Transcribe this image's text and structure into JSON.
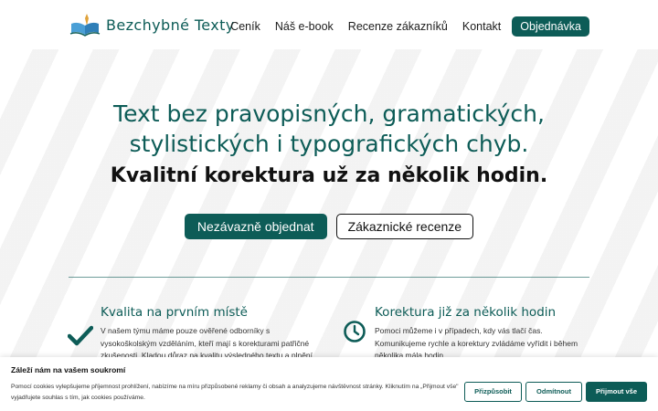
{
  "brand": {
    "name": "Bezchybné Texty",
    "logo_icon": "open-book-quill-icon",
    "accent": "#0d5c57"
  },
  "nav": {
    "items": [
      {
        "label": "Ceník"
      },
      {
        "label": "Náš e-book"
      },
      {
        "label": "Recenze zákazníků"
      },
      {
        "label": "Kontakt"
      }
    ],
    "cta": "Objednávka"
  },
  "hero": {
    "headline_line1": "Text bez pravopisných, gramatických,",
    "headline_line2": "stylistických i typografických chyb.",
    "subheadline": "Kvalitní korektura už za několik hodin.",
    "primary_button": "Nezávazně objednat",
    "secondary_button": "Zákaznické recenze"
  },
  "features": [
    {
      "icon": "checkmark-icon",
      "title": "Kvalita na prvním místě",
      "text": "V našem týmu máme pouze ověřené odborníky s vysokoškolským vzděláním, kteří mají s korekturami patřičné zkušenosti. Kladou důraz na kvalitu výsledného textu a plnění"
    },
    {
      "icon": "clock-icon",
      "title": "Korektura již za několik hodin",
      "text": "Pomoci můžeme i v případech, kdy vás tlačí čas. Komunikujeme rychle a korektury zvládáme vyřídit i během několika mála hodin."
    }
  ],
  "cookie_banner": {
    "title": "Záleží nám na vašem soukromí",
    "text": "Pomocí cookies vylepšujeme příjemnost prohlížení, nabízíme na míru přizpůsobené reklamy či obsah a analyzujeme návštěvnost stránky. Kliknutím na „Přijmout vše\" vyjadřujete souhlas s tím, jak cookies používáme.",
    "customize_button": "Přizpůsobit",
    "reject_button": "Odmítnout",
    "accept_button": "Přijmout vše"
  }
}
